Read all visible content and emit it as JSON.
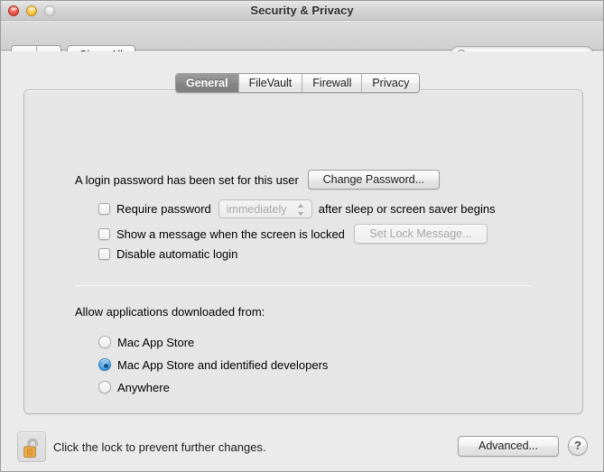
{
  "window": {
    "title": "Security & Privacy",
    "traffic_lights": [
      "close-button",
      "minimize-button",
      "zoom-button"
    ]
  },
  "toolbar": {
    "back_icon": "back-arrow-icon",
    "forward_icon": "forward-arrow-icon",
    "show_all_label": "Show All",
    "search": {
      "icon": "search-icon",
      "value": "",
      "placeholder": ""
    }
  },
  "tabs": [
    {
      "label": "General",
      "selected": true
    },
    {
      "label": "FileVault",
      "selected": false
    },
    {
      "label": "Firewall",
      "selected": false
    },
    {
      "label": "Privacy",
      "selected": false
    }
  ],
  "general": {
    "password_status": "A login password has been set for this user",
    "change_password_label": "Change Password...",
    "require_password": {
      "checked": false,
      "label": "Require password",
      "delay_value": "immediately",
      "suffix": "after sleep or screen saver begins",
      "stepper_icon": "stepper-arrows-icon"
    },
    "lock_message": {
      "checked": false,
      "label": "Show a message when the screen is locked",
      "button_label": "Set Lock Message..."
    },
    "disable_automatic_login": {
      "checked": false,
      "label": "Disable automatic login"
    },
    "allow_apps_label": "Allow applications downloaded from:",
    "allow_apps_options": [
      {
        "label": "Mac App Store",
        "selected": false
      },
      {
        "label": "Mac App Store and identified developers",
        "selected": true
      },
      {
        "label": "Anywhere",
        "selected": false
      }
    ]
  },
  "bottom": {
    "lock_icon": "unlocked-padlock-icon",
    "lock_caption": "Click the lock to prevent further changes.",
    "advanced_label": "Advanced...",
    "help_label": "?"
  },
  "colors": {
    "accent": "#3c98e0",
    "tab_selected_bg": "#8c8c8c",
    "lock_gold": "#e8a13a",
    "window_bg": "#ebebeb"
  }
}
